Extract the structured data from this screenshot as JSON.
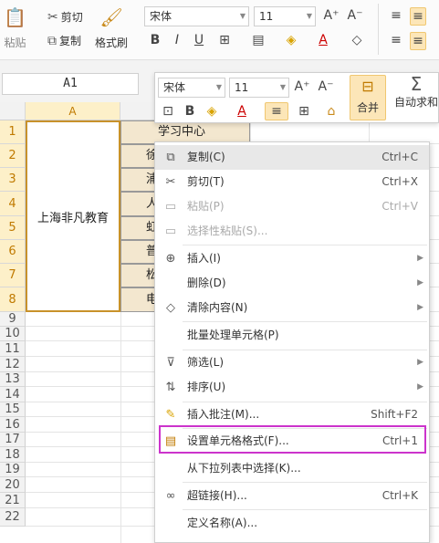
{
  "ribbon": {
    "paste": "粘贴",
    "cut": "剪切",
    "copy": "复制",
    "format_painter": "格式刷",
    "font_name": "宋体",
    "font_size": "11"
  },
  "name_box": "A1",
  "mini_toolbar": {
    "font_name": "宋体",
    "font_size": "11",
    "merge": "合并",
    "autosum": "自动求和"
  },
  "columns": [
    "A"
  ],
  "rows": [
    "1",
    "2",
    "3",
    "4",
    "5",
    "6",
    "7",
    "8",
    "9",
    "10",
    "11",
    "12",
    "13",
    "14",
    "15",
    "16",
    "17",
    "18",
    "19",
    "20",
    "21",
    "22"
  ],
  "cells": {
    "merged_a": "上海非凡教育",
    "b1": "学习中心",
    "b_partial": [
      "徐",
      "浦",
      "人",
      "虹",
      "普",
      "松",
      "电"
    ]
  },
  "context_menu": [
    {
      "label": "复制(C)",
      "shortcut": "Ctrl+C",
      "icon": "copy-icon"
    },
    {
      "label": "剪切(T)",
      "shortcut": "Ctrl+X",
      "icon": "cut-icon"
    },
    {
      "label": "粘贴(P)",
      "shortcut": "Ctrl+V",
      "icon": "paste-icon"
    },
    {
      "label": "选择性粘贴(S)...",
      "shortcut": "",
      "icon": "paste-special-icon"
    },
    {
      "label": "插入(I)",
      "shortcut": "",
      "icon": "insert-icon"
    },
    {
      "label": "删除(D)",
      "shortcut": "",
      "icon": ""
    },
    {
      "label": "清除内容(N)",
      "shortcut": "",
      "icon": "eraser-icon"
    },
    {
      "label": "批量处理单元格(P)",
      "shortcut": "",
      "icon": ""
    },
    {
      "label": "筛选(L)",
      "shortcut": "",
      "icon": "filter-icon"
    },
    {
      "label": "排序(U)",
      "shortcut": "",
      "icon": "sort-icon"
    },
    {
      "label": "插入批注(M)...",
      "shortcut": "Shift+F2",
      "icon": "comment-icon"
    },
    {
      "label": "设置单元格格式(F)...",
      "shortcut": "Ctrl+1",
      "icon": "format-cells-icon"
    },
    {
      "label": "从下拉列表中选择(K)...",
      "shortcut": "",
      "icon": ""
    },
    {
      "label": "超链接(H)...",
      "shortcut": "Ctrl+K",
      "icon": "link-icon"
    },
    {
      "label": "定义名称(A)...",
      "shortcut": "",
      "icon": ""
    }
  ],
  "colors": {
    "highlight": "#cc33cc",
    "selection_border": "#c8922a",
    "active_header": "#fdf0c9",
    "cell_tan": "#f3e7cf"
  }
}
